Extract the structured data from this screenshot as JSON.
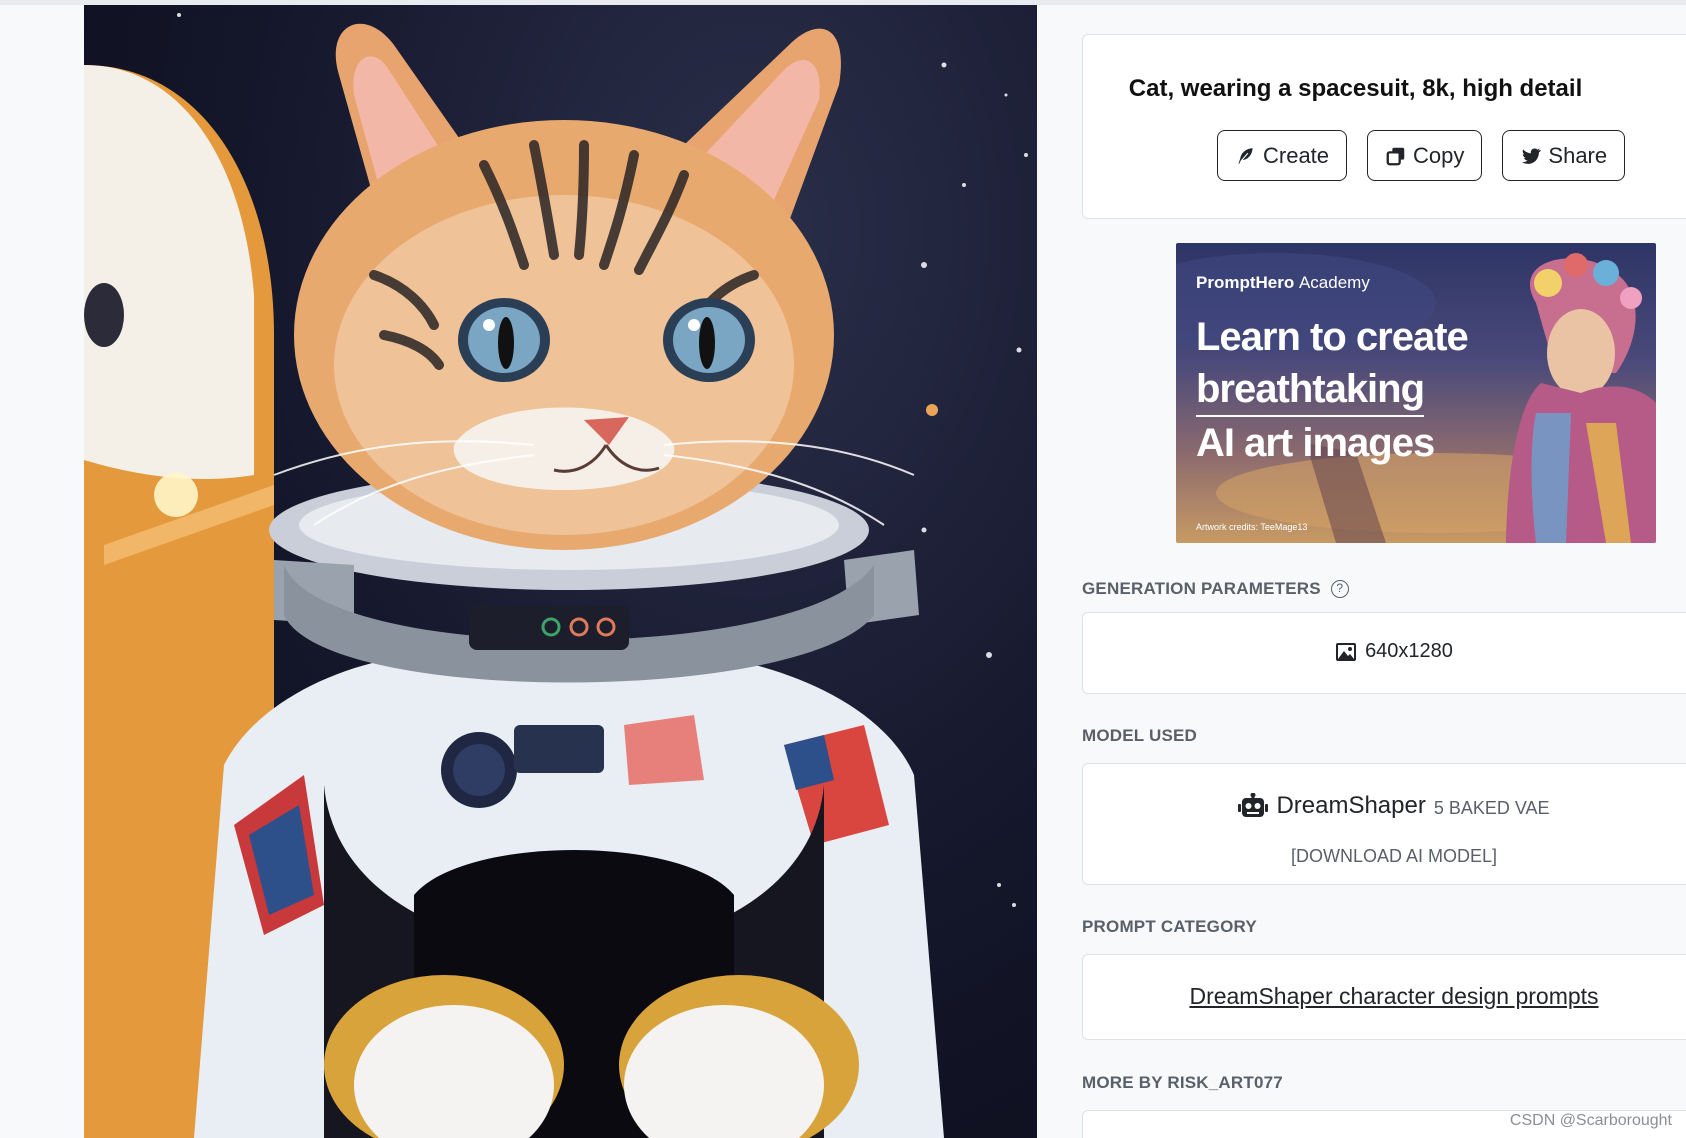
{
  "prompt": {
    "text": "Cat, wearing a spacesuit, 8k, high detail",
    "buttons": {
      "create": "Create",
      "copy": "Copy",
      "share": "Share"
    }
  },
  "banner": {
    "brand": "PromptHero",
    "brand_suffix": "Academy",
    "headline": [
      "Learn to create",
      "breathtaking",
      "AI art images"
    ],
    "credits": "Artwork credits: TeeMage13"
  },
  "sections": {
    "generation_parameters": {
      "title": "GENERATION PARAMETERS",
      "help_icon": "?",
      "dimensions": "640x1280"
    },
    "model_used": {
      "title": "MODEL USED",
      "model_name": "DreamShaper",
      "model_version": "5 BAKED VAE",
      "download": "[DOWNLOAD AI MODEL]"
    },
    "prompt_category": {
      "title": "PROMPT CATEGORY",
      "link": "DreamShaper character design prompts"
    },
    "more_by": {
      "title": "MORE BY RISK_ART077"
    }
  },
  "watermark": "CSDN @Scarborought",
  "colors": {
    "accent_dark": "#212529",
    "muted_text": "#5a6069",
    "card_border": "#dee2e6"
  }
}
